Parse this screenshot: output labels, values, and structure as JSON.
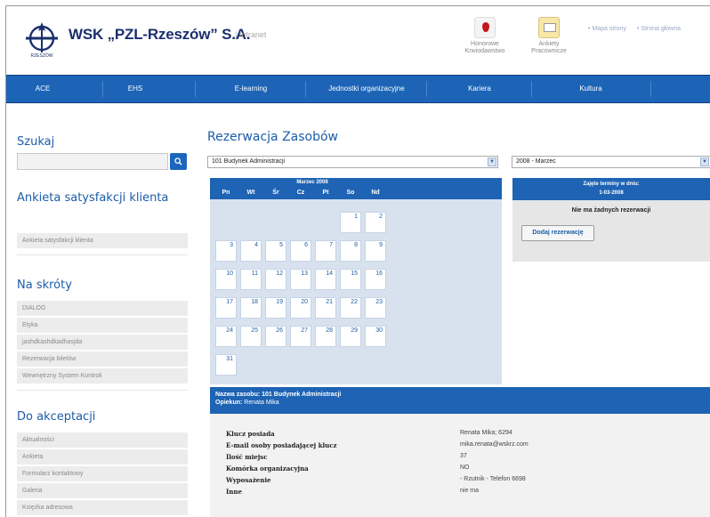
{
  "header": {
    "brand": "WSK „PZL-Rzeszów” S.A.",
    "section": "| Intranet",
    "icons": [
      {
        "label1": "Honorowe",
        "label2": "Krwiodawstwo",
        "icon": "blood-drop-icon"
      },
      {
        "label1": "Ankiety",
        "label2": "Pracownicze",
        "icon": "survey-icon"
      }
    ],
    "links": [
      "• Mapa strony",
      "• Strona główna"
    ]
  },
  "nav": [
    "ACE",
    "EHS",
    "E-learning",
    "Jednostki organizacyjne",
    "Kariera",
    "Kultura"
  ],
  "sidebar": {
    "search_title": "Szukaj",
    "survey_title": "Ankieta satysfakcji klienta",
    "survey_items": [
      "Ankieta satysfakcji klienta"
    ],
    "shortcuts_title": "Na skróty",
    "shortcuts": [
      "DIALOG",
      "Etyka",
      "jashdkashdkadhasjda",
      "Rezerwacja biletów",
      "Wewnętrzny System Kontroli"
    ],
    "accept_title": "Do akceptacji",
    "accept_items": [
      "Aktualności",
      "Ankieta",
      "Formularz kontaktowy",
      "Galeria",
      "Księżka adresowa"
    ]
  },
  "main": {
    "title": "Rezerwacja Zasobów",
    "resource_select": "101 Budynek Administracji",
    "month_select": "2008 - Marzec"
  },
  "calendar": {
    "month": "Marzec 2008",
    "weekdays": [
      "Pn",
      "Wt",
      "Śr",
      "Cz",
      "Pt",
      "So",
      "Nd"
    ],
    "days": [
      [
        "",
        "",
        "",
        "",
        "",
        "1",
        "2"
      ],
      [
        "3",
        "4",
        "5",
        "6",
        "7",
        "8",
        "9"
      ],
      [
        "10",
        "11",
        "12",
        "13",
        "14",
        "15",
        "16"
      ],
      [
        "17",
        "18",
        "19",
        "20",
        "21",
        "22",
        "23"
      ],
      [
        "24",
        "25",
        "26",
        "27",
        "28",
        "29",
        "30"
      ],
      [
        "31",
        "",
        "",
        "",
        "",
        "",
        ""
      ]
    ]
  },
  "booking": {
    "title": "Zajęte terminy w dniu:",
    "date": "1-03-2008",
    "message": "Nie ma żadnych rezerwacji",
    "button": "Dodaj rezerwację"
  },
  "resource": {
    "name_label": "Nazwa zasobu:",
    "name": "101 Budynek Administracji",
    "keeper_label": "Opiekun:",
    "keeper": "Renata Mika",
    "details": [
      {
        "k": "Klucz posiada",
        "v": "Renata Mika; 6294"
      },
      {
        "k": "E-mail osoby posiadającej klucz",
        "v": "mika.renata@wskrz.com"
      },
      {
        "k": "Ilość miejsc",
        "v": "37"
      },
      {
        "k": "Komórka organizacyjna",
        "v": "NO"
      },
      {
        "k": "Wyposażenie",
        "v": "- Rzutnik - Telefon 6698"
      },
      {
        "k": "Inne",
        "v": "nie ma"
      }
    ]
  }
}
